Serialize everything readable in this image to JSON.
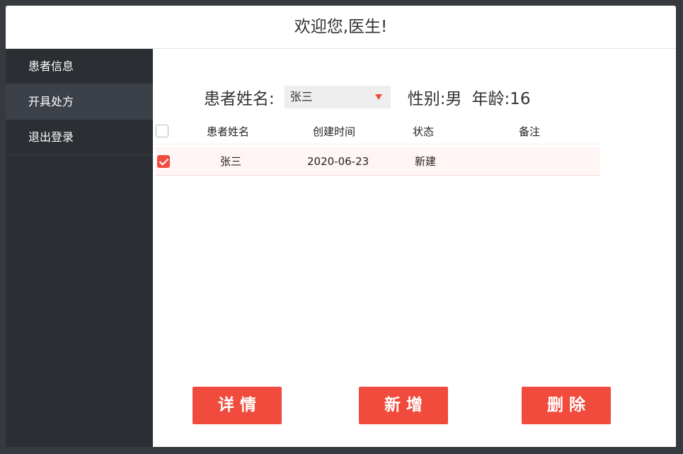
{
  "header": {
    "title": "欢迎您,医生!"
  },
  "sidebar": {
    "items": [
      {
        "label": "患者信息",
        "active": false
      },
      {
        "label": "开具处方",
        "active": true
      },
      {
        "label": "退出登录",
        "active": false
      }
    ]
  },
  "patient": {
    "label": "患者姓名:",
    "selected_name": "张三",
    "gender_text": "性别:男",
    "age_text": "年龄:16"
  },
  "table": {
    "columns": [
      "患者姓名",
      "创建时间",
      "状态",
      "备注"
    ],
    "select_all_checked": false,
    "rows": [
      {
        "checked": true,
        "name": "张三",
        "created": "2020-06-23",
        "status": "新建",
        "note": ""
      }
    ]
  },
  "actions": {
    "detail_label": "详情",
    "add_label": "新增",
    "delete_label": "删除"
  },
  "colors": {
    "accent": "#f04b3c",
    "sidebar_bg": "#2b2e33",
    "sidebar_active": "#3c4048"
  }
}
